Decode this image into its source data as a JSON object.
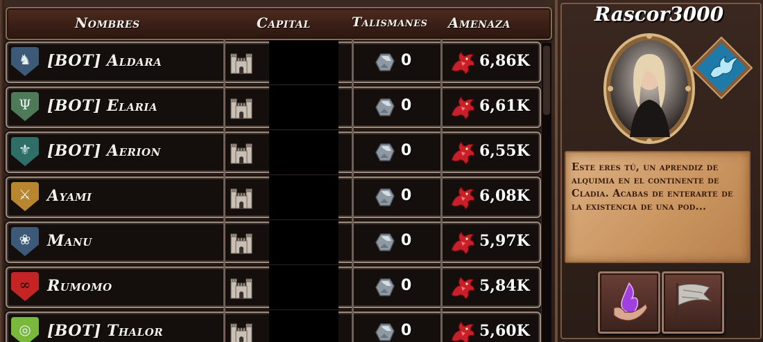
{
  "leaderboard": {
    "columns": {
      "names": "Nombres",
      "capital": "Capital",
      "talismans": "Talismanes",
      "threat": "Amenaza"
    },
    "rows": [
      {
        "name": "[BOT] Aldara",
        "talismans": "0",
        "threat": "6,86K",
        "shield_color": "#3c5a78",
        "emblem": "dragon-emblem-icon"
      },
      {
        "name": "[BOT] Elaria",
        "talismans": "0",
        "threat": "6,61K",
        "shield_color": "#4e7a5a",
        "emblem": "tree-emblem-icon"
      },
      {
        "name": "[BOT] Aerion",
        "talismans": "0",
        "threat": "6,55K",
        "shield_color": "#2e6e66",
        "emblem": "crest-emblem-icon"
      },
      {
        "name": "Ayami",
        "talismans": "0",
        "threat": "6,08K",
        "shield_color": "#b8862e",
        "emblem": "sword-emblem-icon"
      },
      {
        "name": "Manu",
        "talismans": "0",
        "threat": "5,97K",
        "shield_color": "#3c5a78",
        "emblem": "knot-emblem-icon"
      },
      {
        "name": "Rumomo",
        "talismans": "0",
        "threat": "5,84K",
        "shield_color": "#c42424",
        "emblem": "chain-emblem-icon"
      },
      {
        "name": "[BOT] Thalor",
        "talismans": "0",
        "threat": "5,60K",
        "shield_color": "#7ab83c",
        "emblem": "ring-emblem-icon"
      }
    ]
  },
  "player": {
    "name": "Rascor3000",
    "description": "Este eres tú, un aprendiz de alquimia en el continente de Cladia. Acabas de enterarte de la existencia de una pod...",
    "emblem_color": "#1e7aa8",
    "buttons": [
      "magic-hand-icon",
      "war-flag-icon"
    ]
  }
}
